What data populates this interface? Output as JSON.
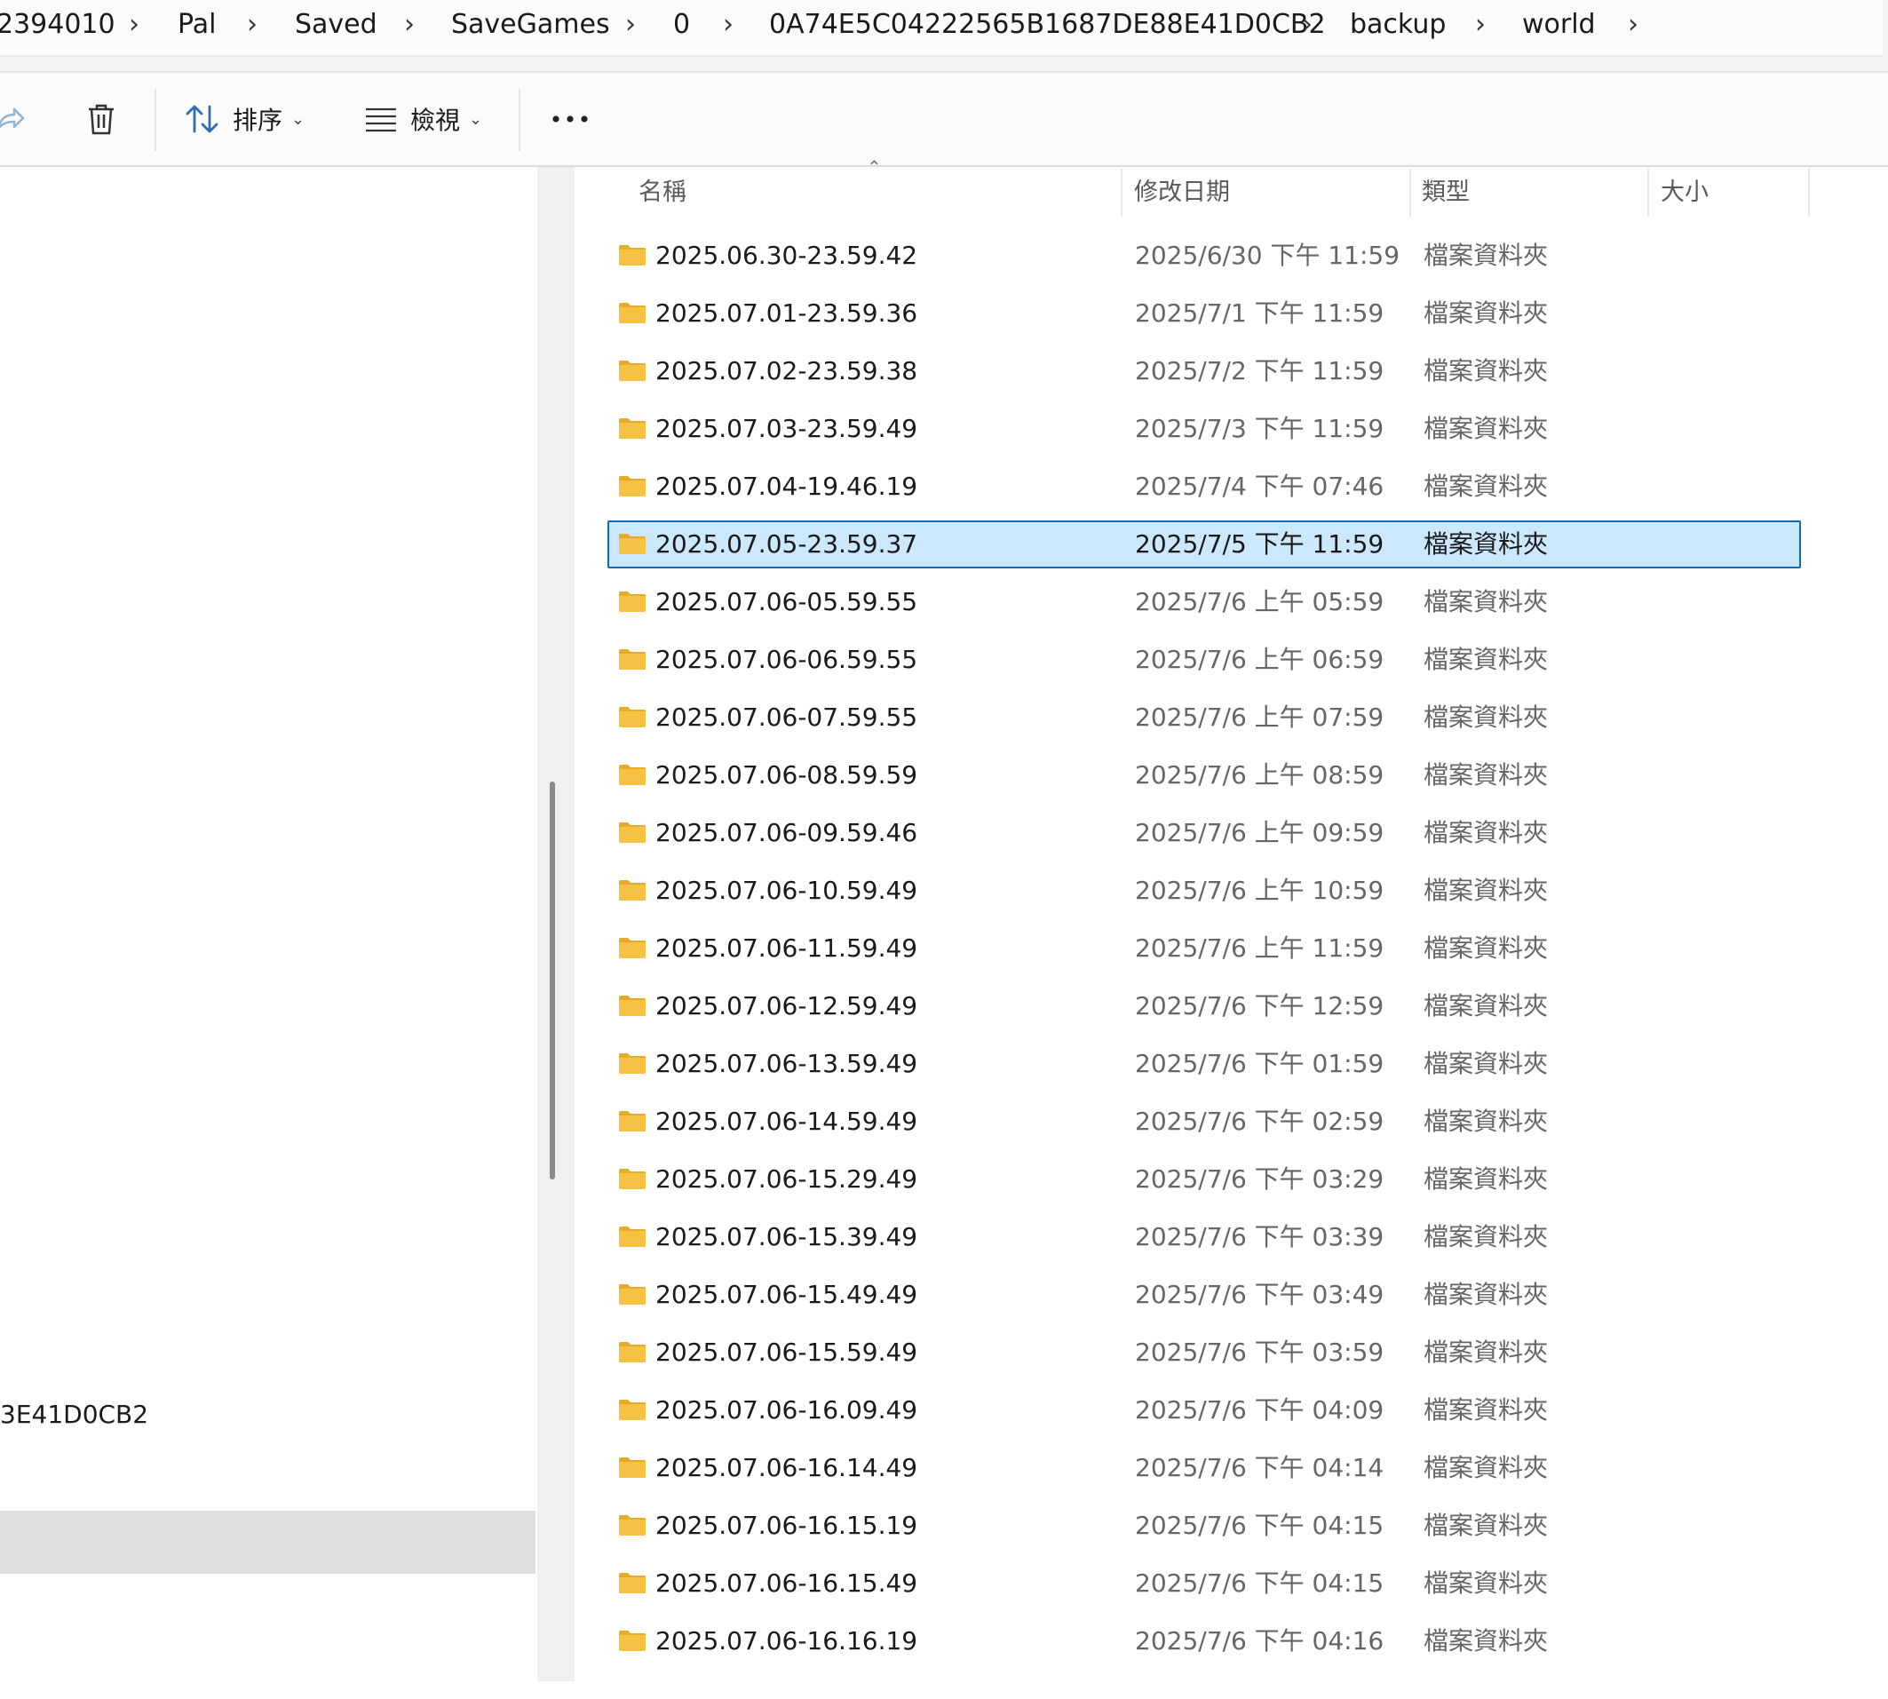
{
  "breadcrumb": {
    "items": [
      "2394010",
      "Pal",
      "Saved",
      "SaveGames",
      "0",
      "0A74E5C04222565B1687DE88E41D0CB2",
      "backup",
      "world"
    ]
  },
  "toolbar": {
    "sort_label": "排序",
    "view_label": "檢視"
  },
  "nav": {
    "partial_item": "3E41D0CB2"
  },
  "columns": {
    "name": "名稱",
    "date": "修改日期",
    "type": "類型",
    "size": "大小"
  },
  "files": [
    {
      "name": "2025.06.30-23.59.42",
      "date": "2025/6/30 下午 11:59",
      "type": "檔案資料夾"
    },
    {
      "name": "2025.07.01-23.59.36",
      "date": "2025/7/1 下午 11:59",
      "type": "檔案資料夾"
    },
    {
      "name": "2025.07.02-23.59.38",
      "date": "2025/7/2 下午 11:59",
      "type": "檔案資料夾"
    },
    {
      "name": "2025.07.03-23.59.49",
      "date": "2025/7/3 下午 11:59",
      "type": "檔案資料夾"
    },
    {
      "name": "2025.07.04-19.46.19",
      "date": "2025/7/4 下午 07:46",
      "type": "檔案資料夾"
    },
    {
      "name": "2025.07.05-23.59.37",
      "date": "2025/7/5 下午 11:59",
      "type": "檔案資料夾",
      "selected": true
    },
    {
      "name": "2025.07.06-05.59.55",
      "date": "2025/7/6 上午 05:59",
      "type": "檔案資料夾"
    },
    {
      "name": "2025.07.06-06.59.55",
      "date": "2025/7/6 上午 06:59",
      "type": "檔案資料夾"
    },
    {
      "name": "2025.07.06-07.59.55",
      "date": "2025/7/6 上午 07:59",
      "type": "檔案資料夾"
    },
    {
      "name": "2025.07.06-08.59.59",
      "date": "2025/7/6 上午 08:59",
      "type": "檔案資料夾"
    },
    {
      "name": "2025.07.06-09.59.46",
      "date": "2025/7/6 上午 09:59",
      "type": "檔案資料夾"
    },
    {
      "name": "2025.07.06-10.59.49",
      "date": "2025/7/6 上午 10:59",
      "type": "檔案資料夾"
    },
    {
      "name": "2025.07.06-11.59.49",
      "date": "2025/7/6 上午 11:59",
      "type": "檔案資料夾"
    },
    {
      "name": "2025.07.06-12.59.49",
      "date": "2025/7/6 下午 12:59",
      "type": "檔案資料夾"
    },
    {
      "name": "2025.07.06-13.59.49",
      "date": "2025/7/6 下午 01:59",
      "type": "檔案資料夾"
    },
    {
      "name": "2025.07.06-14.59.49",
      "date": "2025/7/6 下午 02:59",
      "type": "檔案資料夾"
    },
    {
      "name": "2025.07.06-15.29.49",
      "date": "2025/7/6 下午 03:29",
      "type": "檔案資料夾"
    },
    {
      "name": "2025.07.06-15.39.49",
      "date": "2025/7/6 下午 03:39",
      "type": "檔案資料夾"
    },
    {
      "name": "2025.07.06-15.49.49",
      "date": "2025/7/6 下午 03:49",
      "type": "檔案資料夾"
    },
    {
      "name": "2025.07.06-15.59.49",
      "date": "2025/7/6 下午 03:59",
      "type": "檔案資料夾"
    },
    {
      "name": "2025.07.06-16.09.49",
      "date": "2025/7/6 下午 04:09",
      "type": "檔案資料夾"
    },
    {
      "name": "2025.07.06-16.14.49",
      "date": "2025/7/6 下午 04:14",
      "type": "檔案資料夾"
    },
    {
      "name": "2025.07.06-16.15.19",
      "date": "2025/7/6 下午 04:15",
      "type": "檔案資料夾"
    },
    {
      "name": "2025.07.06-16.15.49",
      "date": "2025/7/6 下午 04:15",
      "type": "檔案資料夾"
    },
    {
      "name": "2025.07.06-16.16.19",
      "date": "2025/7/6 下午 04:16",
      "type": "檔案資料夾"
    }
  ],
  "colors": {
    "selection_bg": "#cce8ff",
    "selection_border": "#0f6cbd",
    "folder": "#f6c244"
  }
}
